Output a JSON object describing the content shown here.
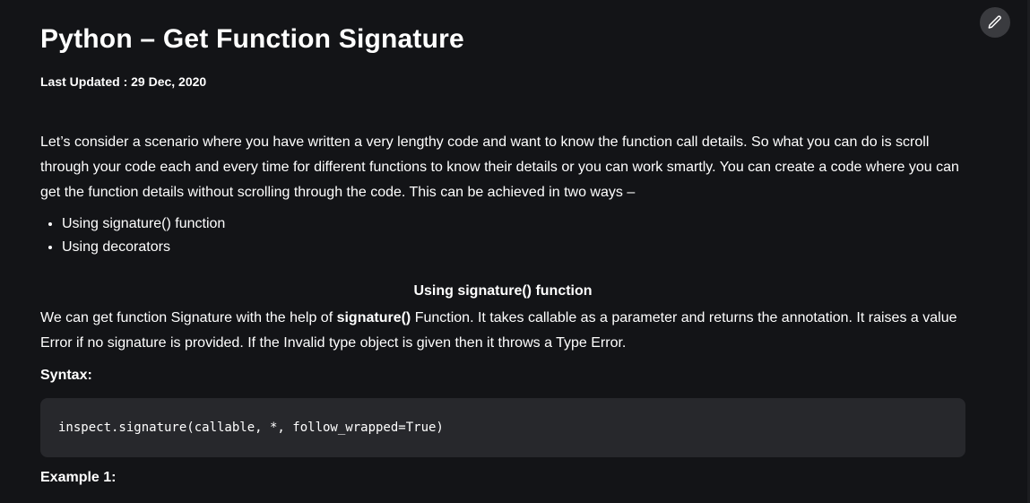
{
  "article": {
    "title": "Python – Get Function Signature",
    "last_updated_label": "Last Updated : 29 Dec, 2020",
    "intro": "Let’s consider a scenario where you have written a very lengthy code and want to know the function call details. So what you can do is scroll through your code each and every time for different functions to know their details or you can work smartly. You can create a code where you can get the function details without scrolling through the code. This can be achieved in two ways –",
    "bullets": [
      "Using signature() function",
      "Using decorators"
    ],
    "section_heading": "Using signature() function",
    "para_before_bold": "We can get function Signature with the help of ",
    "para_bold": "signature()",
    "para_after_bold": " Function. It takes callable as a parameter and returns the annotation. It raises a value Error if no signature is provided. If the Invalid type object is given then it throws a Type Error.",
    "syntax_label": "Syntax:",
    "syntax_code": "inspect.signature(callable, *, follow_wrapped=True)",
    "example_label": "Example 1:"
  },
  "toolbar": {
    "edit_icon": "pencil-icon"
  },
  "colors": {
    "background": "#131417",
    "code_background": "#27282c",
    "text": "#ffffff",
    "edit_button_bg": "#3a3b3f"
  }
}
